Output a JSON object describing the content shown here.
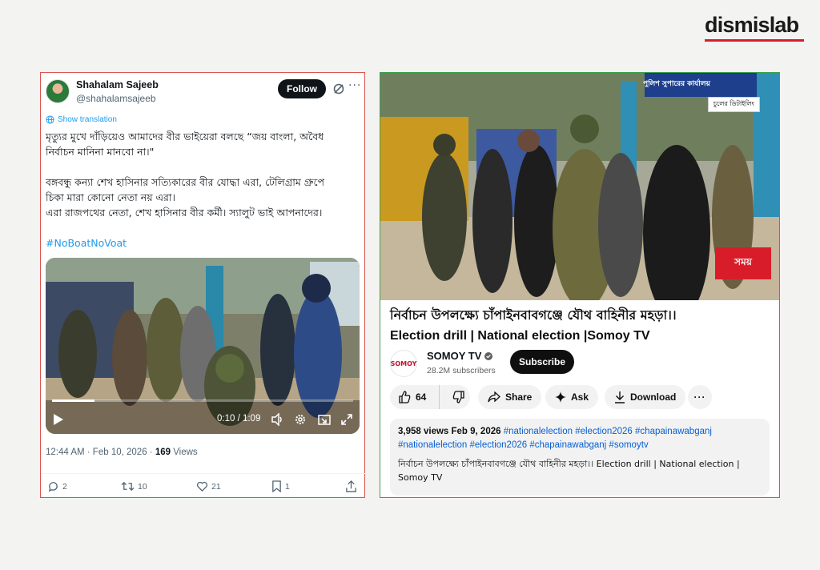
{
  "brand": {
    "name": "dismislab"
  },
  "tweet": {
    "author_name": "Shahalam Sajeeb",
    "author_handle": "@shahalamsajeeb",
    "follow_label": "Follow",
    "show_translation": "Show translation",
    "line1": "মৃত্যুর মুখে দাঁড়িয়েও আমাদের বীর ভাইয়েরা বলছে “জয় বাংলা, অবৈধ",
    "line2": "নির্বাচন মানিনা মানবো না।\"",
    "line3": "বঙ্গবন্ধু কন্যা শেখ হাসিনার সত্যিকারের বীর যোদ্ধা এরা, টেলিগ্রাম গ্রুপে",
    "line4": "চিকা মারা কোনো নেতা নয় এরা।",
    "line5": "এরা রাজপথের নেতা, শেখ হাসিনার বীর কর্মী। স্যালুট ভাই আপনাদের।",
    "hashtag": "#NoBoatNoVoat",
    "video_time": "0:10 / 1:09",
    "timestamp": "12:44 AM · Feb 10, 2026 · ",
    "views_count": "169",
    "views_label": " Views",
    "replies": "2",
    "reposts": "10",
    "likes": "21",
    "bookmarks": "1"
  },
  "youtube": {
    "thumb_overlay_text": "চুলের ডিটাইলিং",
    "thumb_sign_text": "পুলিশ সুপারের কার্যালয়",
    "somoy_logo": "সময়",
    "title_line1": "নির্বাচন উপলক্ষ্যে চাঁপাইনবাবগঞ্জে যৌথ বাহিনীর মহড়া।।",
    "title_line2": "Election drill | National election |Somoy TV",
    "channel_logo": "SOMOY",
    "channel_name": "SOMOY TV",
    "subscribers": "28.2M subscribers",
    "subscribe_label": "Subscribe",
    "likes": "64",
    "share_label": "Share",
    "ask_label": "Ask",
    "download_label": "Download",
    "views_date": "3,958 views  Feb 9, 2026 ",
    "tags_line1": "#nationalelection #election2026 #chapainawabganj",
    "tags_line2": "#nationalelection #election2026 #chapainawabganj #somoytv",
    "desc_line1": "নির্বাচন উপলক্ষ্যে চাঁপাইনবাবগঞ্জে যৌথ বাহিনীর মহড়া।। Election drill | National election |",
    "desc_line2": "Somoy TV"
  },
  "colors": {
    "accent_red": "#d91c2a",
    "twitter_blue": "#1d9bf0",
    "youtube_link": "#065fd4",
    "tw_border": "#d9534f",
    "yt_border": "#3ba34d"
  }
}
